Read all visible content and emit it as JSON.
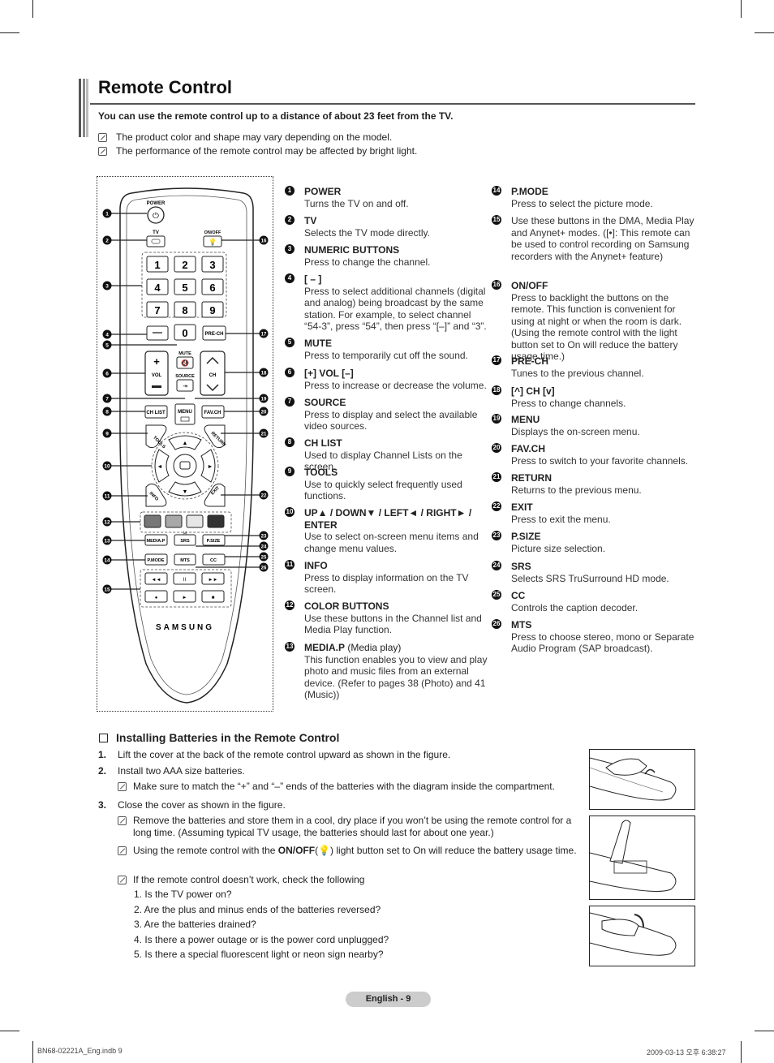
{
  "page": {
    "title": "Remote Control",
    "intro": "You can use the remote control up to a distance of about 23 feet from the TV.",
    "notes": [
      "The product color and shape may vary depending on the model.",
      "The performance of the remote control may be affected by bright light."
    ]
  },
  "remote": {
    "brand": "SAMSUNG",
    "labels": {
      "power": "POWER",
      "tv": "TV",
      "onoff": "ON/OFF",
      "mute": "MUTE",
      "vol": "VOL",
      "source": "SOURCE",
      "ch": "CH",
      "chlist": "CH LIST",
      "menu": "MENU",
      "favch": "FAV.CH",
      "tools": "TOOLS",
      "return": "RETURN",
      "info": "INFO",
      "exit": "EXIT",
      "mediap": "MEDIA.P",
      "srs": "SRS",
      "psize": "P.SIZE",
      "pmode": "P.MODE",
      "mts": "MTS",
      "cc": "CC",
      "prech": "PRE-CH"
    },
    "digits": [
      "1",
      "2",
      "3",
      "4",
      "5",
      "6",
      "7",
      "8",
      "9",
      "0"
    ],
    "color_buttons": [
      "#777777",
      "#a8a8a8",
      "#e6e6e6",
      "#333333"
    ],
    "callouts_left": [
      "1",
      "2",
      "3",
      "4",
      "5",
      "6",
      "7",
      "8",
      "9",
      "10",
      "11",
      "12",
      "13",
      "14",
      "15"
    ],
    "callouts_right": [
      "16",
      "17",
      "18",
      "19",
      "20",
      "21",
      "22",
      "23",
      "24",
      "25",
      "26"
    ]
  },
  "descriptions": [
    {
      "n": "1",
      "name": "POWER",
      "text": "Turns the TV on and off."
    },
    {
      "n": "2",
      "name": "TV",
      "text": "Selects the TV mode directly."
    },
    {
      "n": "3",
      "name": "NUMERIC BUTTONS",
      "text": "Press to change the channel."
    },
    {
      "n": "4",
      "name": "[ – ]",
      "text": "Press to select additional channels (digital and analog) being broadcast by the same station. For example, to select channel “54-3”, press “54”, then press “[–]” and “3”."
    },
    {
      "n": "5",
      "name": "MUTE",
      "text": "Press to temporarily cut off the sound."
    },
    {
      "n": "6",
      "name": "[+] VOL [–]",
      "text": "Press to increase or decrease the volume."
    },
    {
      "n": "7",
      "name": "SOURCE",
      "text": "Press to display and select the available video sources."
    },
    {
      "n": "8",
      "name": "CH LIST",
      "text": "Used to display Channel Lists on the screen."
    },
    {
      "n": "9",
      "name": "TOOLS",
      "text": "Use to quickly select frequently used functions."
    },
    {
      "n": "10",
      "name": "UP▲ / DOWN▼ / LEFT◄ / RIGHT► / ENTER",
      "text": "Use to select on-screen menu items and change menu values."
    },
    {
      "n": "11",
      "name": "INFO",
      "text": "Press to display information on the TV screen."
    },
    {
      "n": "12",
      "name": "COLOR BUTTONS",
      "text": "Use these buttons in the Channel list and Media Play function."
    },
    {
      "n": "13",
      "name": "MEDIA.P",
      "name_suffix": "(Media play)",
      "text": "This function enables you to view and play photo and music files from an external device. (Refer to pages 38 (Photo) and 41 (Music))"
    },
    {
      "n": "14",
      "name": "P.MODE",
      "text": "Press to select the picture mode."
    },
    {
      "n": "15",
      "name": "",
      "text": "Use these buttons in the DMA, Media Play and Anynet+ modes. ([•]: This remote can be used to control recording on Samsung recorders with the Anynet+ feature)"
    },
    {
      "n": "16",
      "name": "ON/OFF",
      "text": "Press to backlight the buttons on the remote. This function is convenient for using at night or when the room is dark. (Using the remote control with the light button set to On will reduce the battery usage time.)"
    },
    {
      "n": "17",
      "name": "PRE-CH",
      "text": "Tunes to the previous channel."
    },
    {
      "n": "18",
      "name": "[^] CH [v]",
      "text": "Press to change channels."
    },
    {
      "n": "19",
      "name": "MENU",
      "text": "Displays the on-screen menu."
    },
    {
      "n": "20",
      "name": "FAV.CH",
      "text": "Press to switch to your favorite channels."
    },
    {
      "n": "21",
      "name": "RETURN",
      "text": "Returns to the previous menu."
    },
    {
      "n": "22",
      "name": "EXIT",
      "text": "Press to exit the menu."
    },
    {
      "n": "23",
      "name": "P.SIZE",
      "text": "Picture size selection."
    },
    {
      "n": "24",
      "name": "SRS",
      "text": "Selects SRS TruSurround HD mode."
    },
    {
      "n": "25",
      "name": "CC",
      "text": "Controls the caption decoder."
    },
    {
      "n": "26",
      "name": "MTS",
      "text": "Press to choose stereo, mono or Separate Audio Program (SAP broadcast)."
    }
  ],
  "batteries": {
    "heading": "Installing Batteries in the Remote Control",
    "steps": [
      {
        "n": "1.",
        "text": "Lift the cover at the back of the remote control upward as shown in the figure."
      },
      {
        "n": "2.",
        "text": "Install two AAA size batteries."
      },
      {
        "n": "3.",
        "text": "Close the cover as shown in the figure."
      }
    ],
    "note_step2": "Make sure to match the “+” and “–” ends of the batteries with the diagram inside the compartment.",
    "note_store": "Remove the batteries and store them in a cool, dry place if you won’t be using the remote control for a long time. (Assuming typical TV usage, the batteries should last for about one year.)",
    "note_light_prefix": "Using the remote control with the ",
    "note_light_bold": "ON/OFF",
    "note_light_suffix": " light button set to On will reduce the battery usage time.",
    "note_check": "If the remote control doesn’t work, check the following",
    "checks": [
      "1.  Is the TV power on?",
      "2.  Are the plus and minus ends of the batteries reversed?",
      "3.  Are the batteries drained?",
      "4.  Is there a power outage or is the power cord unplugged?",
      "5.  Is there a special fluorescent light or neon sign nearby?"
    ]
  },
  "footer": {
    "page_label": "English - 9",
    "slug_left": "BN68-02221A_Eng.indb   9",
    "slug_right": "2009-03-13   오후 6:38:27"
  }
}
